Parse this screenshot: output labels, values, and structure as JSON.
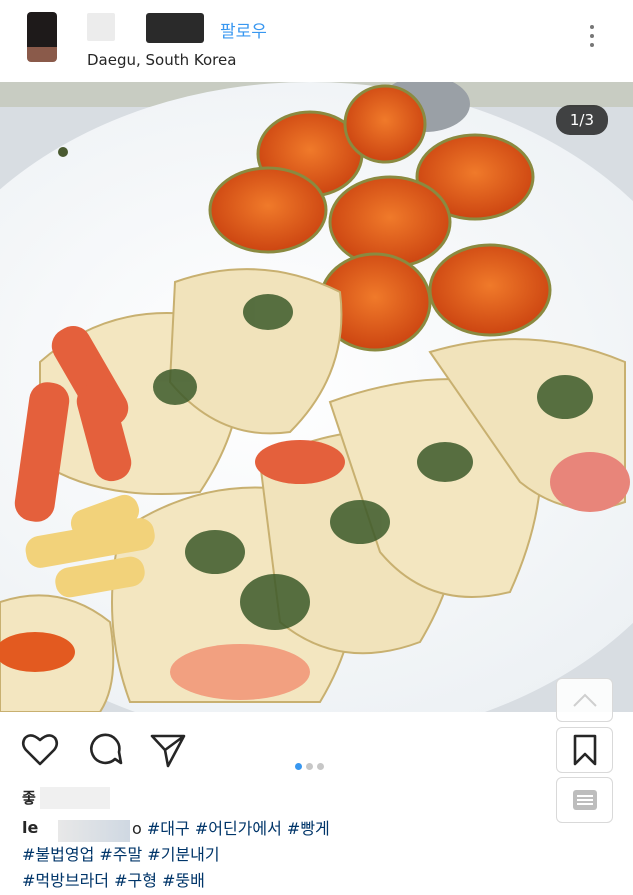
{
  "header": {
    "follow_label": "팔로우",
    "location": "Daegu, South Korea",
    "more_icon": "more-vertical-icon"
  },
  "photo": {
    "counter": "1/3",
    "description_icon": "food-photo"
  },
  "carousel": {
    "position": 1,
    "total": 3,
    "active_color": "#3897f0"
  },
  "actions": {
    "like_icon": "heart-icon",
    "comment_icon": "comment-icon",
    "share_icon": "send-icon",
    "save_icon": "bookmark-icon",
    "up_icon": "chevron-up-icon",
    "list_icon": "list-icon"
  },
  "likes": {
    "prefix": "좋"
  },
  "caption": {
    "username_visible": "le",
    "username_tail": "o",
    "line1_tags": "#대구 #어딘가에서 #빵게",
    "line2_tags": "#불법영업 #주말 #기분내기",
    "line3_tags": "#먹방브라더 #구형 #뚱배"
  },
  "colors": {
    "link": "#3897f0",
    "hashtag": "#003569",
    "text": "#262626"
  }
}
